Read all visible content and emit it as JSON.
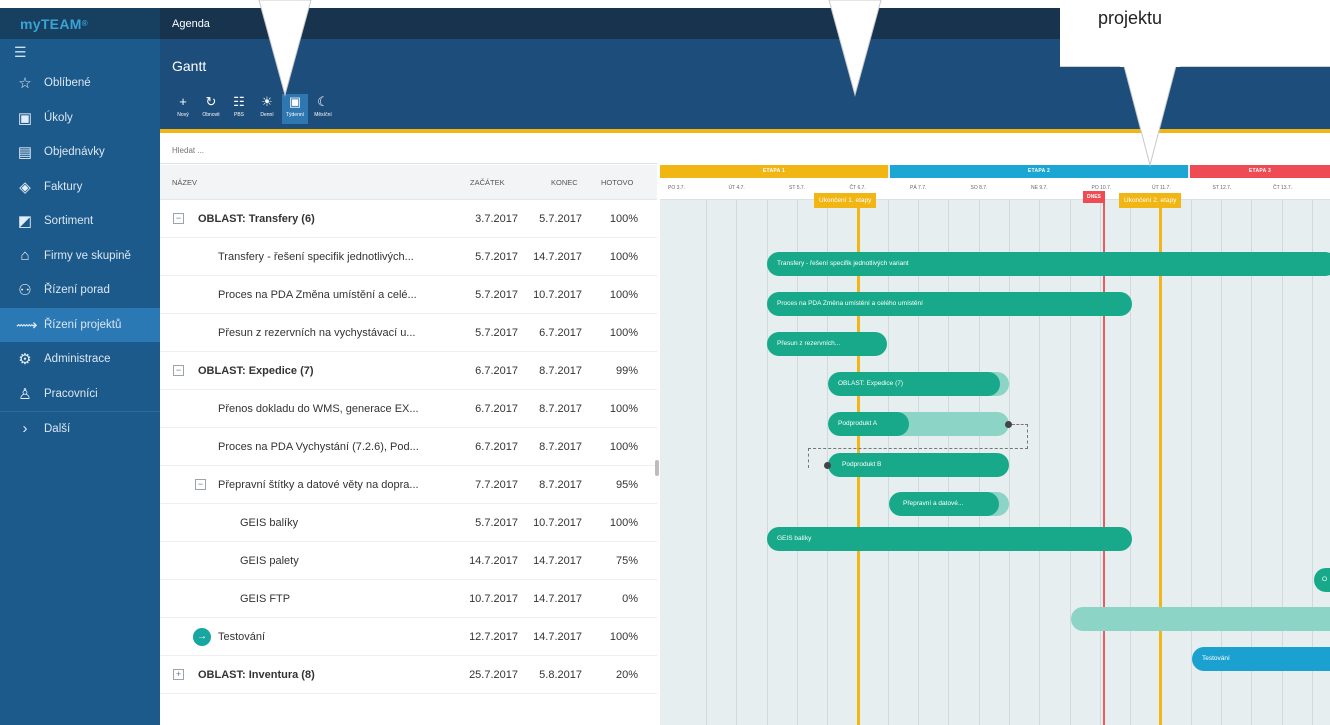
{
  "app": {
    "logo": "myTEAM",
    "logo_mark": "®",
    "menu_icon": "hamburger-icon"
  },
  "topbar": {
    "title": "Agenda"
  },
  "header": {
    "title": "Gantt"
  },
  "toolbar": {
    "buttons": [
      {
        "label": "Nový",
        "icon": "+"
      },
      {
        "label": "Obnovit",
        "icon": "↻"
      },
      {
        "label": "PBS",
        "icon": "☷"
      },
      {
        "label": "Denní",
        "icon": "☀"
      },
      {
        "label": "Týdenní",
        "icon": "▣",
        "selected": true
      },
      {
        "label": "Měsíční",
        "icon": "☾"
      }
    ]
  },
  "sidebar": {
    "items": [
      {
        "label": "Oblíbené",
        "icon": "☆"
      },
      {
        "label": "Úkoly",
        "icon": "▣"
      },
      {
        "label": "Objednávky",
        "icon": "▤"
      },
      {
        "label": "Faktury",
        "icon": "◈"
      },
      {
        "label": "Sortiment",
        "icon": "◩"
      },
      {
        "label": "Firmy ve skupině",
        "icon": "⌂"
      },
      {
        "label": "Řízení porad",
        "icon": "⚇"
      },
      {
        "label": "Řízení projektů",
        "icon": "⟿",
        "active": true
      },
      {
        "label": "Administrace",
        "icon": "⚙"
      },
      {
        "label": "Pracovníci",
        "icon": "♙"
      },
      {
        "label": "Další",
        "icon": "›"
      }
    ]
  },
  "search": {
    "placeholder": "Hledat ..."
  },
  "table": {
    "columns": {
      "name": "NÁZEV",
      "start": "ZAČÁTEK",
      "end": "KONEC",
      "done": "HOTOVO"
    },
    "rows": [
      {
        "name": "OBLAST: Transfery (6)",
        "start": "3.7.2017",
        "end": "5.7.2017",
        "done": "100%",
        "bold": true,
        "level": 0,
        "toggle": "−"
      },
      {
        "name": "Transfery - řešení specifik jednotlivých...",
        "start": "5.7.2017",
        "end": "14.7.2017",
        "done": "100%",
        "level": 1
      },
      {
        "name": "Proces na PDA Změna umístění a celé...",
        "start": "5.7.2017",
        "end": "10.7.2017",
        "done": "100%",
        "level": 1
      },
      {
        "name": "Přesun z rezervních na vychystávací u...",
        "start": "5.7.2017",
        "end": "6.7.2017",
        "done": "100%",
        "level": 1
      },
      {
        "name": "OBLAST: Expedice (7)",
        "start": "6.7.2017",
        "end": "8.7.2017",
        "done": "99%",
        "bold": true,
        "level": 0,
        "toggle": "−"
      },
      {
        "name": "Přenos dokladu do WMS, generace EX...",
        "start": "6.7.2017",
        "end": "8.7.2017",
        "done": "100%",
        "level": 1
      },
      {
        "name": "Proces na PDA Vychystání (7.2.6), Pod...",
        "start": "6.7.2017",
        "end": "8.7.2017",
        "done": "100%",
        "level": 1
      },
      {
        "name": "Přepravní štítky a datové věty na dopra...",
        "start": "7.7.2017",
        "end": "8.7.2017",
        "done": "95%",
        "level": 1,
        "toggle": "−"
      },
      {
        "name": "GEIS balíky",
        "start": "5.7.2017",
        "end": "10.7.2017",
        "done": "100%",
        "level": 2
      },
      {
        "name": "GEIS palety",
        "start": "14.7.2017",
        "end": "14.7.2017",
        "done": "75%",
        "level": 2
      },
      {
        "name": "GEIS FTP",
        "start": "10.7.2017",
        "end": "14.7.2017",
        "done": "0%",
        "level": 2
      },
      {
        "name": "Testování",
        "start": "12.7.2017",
        "end": "14.7.2017",
        "done": "100%",
        "level": 1,
        "icon": "→"
      },
      {
        "name": "OBLAST: Inventura (8)",
        "start": "25.7.2017",
        "end": "5.8.2017",
        "done": "20%",
        "bold": true,
        "level": 0,
        "toggle": "+"
      }
    ]
  },
  "gantt": {
    "stages": [
      "ETAPA 1",
      "ETAPA 2",
      "ETAPA 3"
    ],
    "days": [
      "PO 3.7.",
      "ÚT 4.7.",
      "ST 5.7.",
      "ČT 6.7.",
      "PÁ 7.7.",
      "SO 8.7.",
      "NE 9.7.",
      "PO 10.7.",
      "ÚT 11.7.",
      "ST 12.7.",
      "ČT 13.7."
    ],
    "milestones": [
      "Ukončení 1. etapy",
      "Ukončení 2. etapy"
    ],
    "today_label": "DNES",
    "bars": [
      "Transfery - řešení specifik jednotlivých variant",
      "Proces na PDA Změna umístění a celého umístění",
      "Přesun z rezervních...",
      "OBLAST: Expedice (7)",
      "Podprodukt A",
      "Podprodukt B",
      "Přepravní a datové...",
      "GEIS balíky",
      "O",
      "",
      "Testování"
    ],
    "podprodukt_a_progress": 0.45,
    "colors": {
      "stage1": "#f1b613",
      "stage2": "#1ba6d3",
      "stage3": "#ee4b55",
      "bar": "#17a98a",
      "bar_light": "#8cd4c6",
      "bar_blue": "#1ba1d0"
    }
  },
  "callout": {
    "text": "projektu"
  }
}
